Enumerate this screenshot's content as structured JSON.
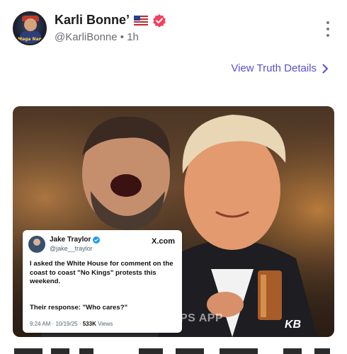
{
  "post": {
    "display_name": "Karli Bonne’",
    "handle": "@KarliBonne",
    "separator": "•",
    "time": "1h",
    "avatar_label": "Maga Nan",
    "details_link": "View Truth Details"
  },
  "embedded_post": {
    "name": "Jake Traylor",
    "handle": "@jake__traylor",
    "brand": "X.com",
    "text": "I asked the White House for comment on the coast to coast  \"No Kings\" protests this weekend.",
    "response": "Their response: \"Who cares?\"",
    "time": "9:24 AM · 10/19/25 ·",
    "views_count": "533K",
    "views_label": " Views"
  },
  "media_overlay": {
    "watermark": "PS APP",
    "signature": "KB"
  },
  "colors": {
    "accent": "#5a4fcf",
    "verified_badge": "#f2405e",
    "x_verified": "#1d9bf0",
    "muted_text": "#6b6b76"
  },
  "icons": [
    "us-flag-icon",
    "verified-badge-icon",
    "more-options-icon",
    "chevron-right-icon",
    "x-verified-icon"
  ]
}
